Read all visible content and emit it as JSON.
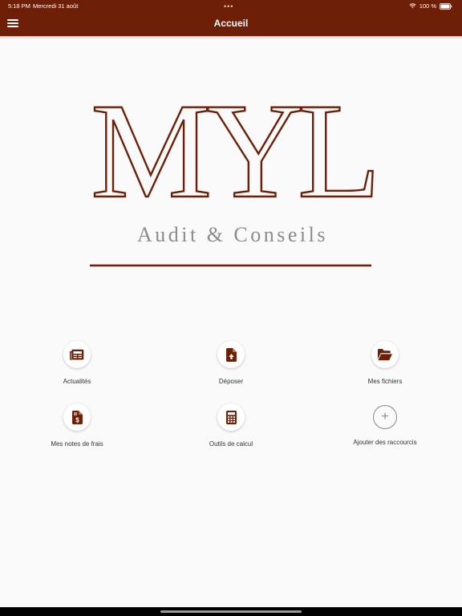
{
  "status_bar": {
    "time": "5:18 PM",
    "date": "Mercredi 31 août",
    "battery": "100 %"
  },
  "header": {
    "title": "Accueil",
    "menu_icon": "hamburger-icon",
    "multitasking_icon": "three-dots-icon"
  },
  "logo": {
    "letters": "MYL",
    "tagline": "Audit & Conseils",
    "color": "#6e1f07",
    "tagline_color": "#8c8c8c"
  },
  "shortcuts": [
    {
      "label": "Actualités",
      "icon": "newspaper-icon"
    },
    {
      "label": "Déposer",
      "icon": "file-upload-icon"
    },
    {
      "label": "Mes fichiers",
      "icon": "folder-open-icon"
    },
    {
      "label": "Mes notes de frais",
      "icon": "invoice-dollar-icon"
    },
    {
      "label": "Outils de calcul",
      "icon": "calculator-icon"
    },
    {
      "label": "Ajouter des raccourcis",
      "icon": "plus-icon"
    }
  ],
  "colors": {
    "brand": "#6e1f07",
    "background": "#fafafa"
  }
}
